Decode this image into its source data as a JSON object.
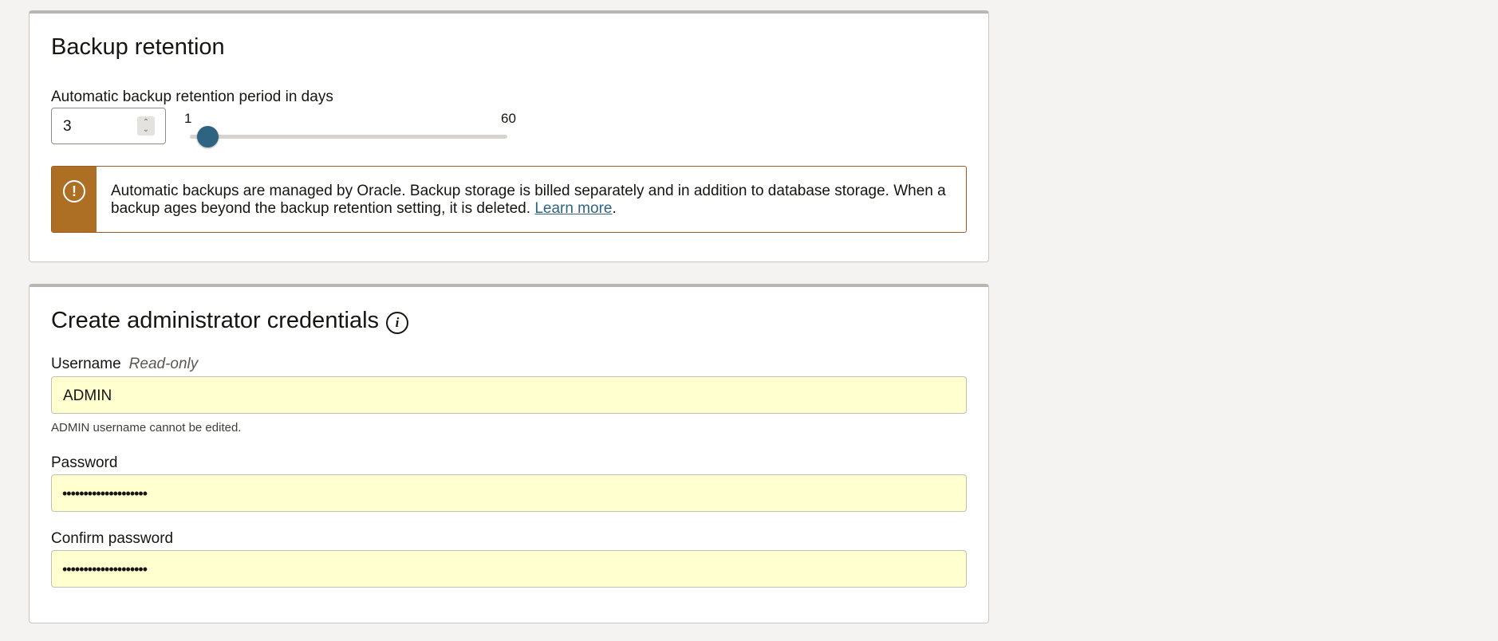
{
  "backup_retention": {
    "title": "Backup retention",
    "period_label": "Automatic backup retention period in days",
    "period_value": "3",
    "slider": {
      "min_label": "1",
      "max_label": "60",
      "value": 3,
      "min": 1,
      "max": 60
    },
    "warning": {
      "text": "Automatic backups are managed by Oracle. Backup storage is billed separately and in addition to database storage. When a backup ages beyond the backup retention setting, it is deleted.",
      "link_label": "Learn more",
      "suffix": "."
    }
  },
  "admin_credentials": {
    "title": "Create administrator credentials",
    "username_label": "Username",
    "readonly_tag": "Read-only",
    "username_value": "ADMIN",
    "username_helper": "ADMIN username cannot be edited.",
    "password_label": "Password",
    "password_value": "••••••••••••••••••••",
    "confirm_label": "Confirm password",
    "confirm_value": "••••••••••••••••••••"
  },
  "icons": {
    "warning": "exclamation-circle-icon",
    "info": "info-icon",
    "stepper": "chevron-up-down-icon"
  },
  "colors": {
    "warning_stripe": "#ac6f24",
    "slider_thumb": "#2f6382",
    "link": "#2e6385",
    "autofill_bg": "#ffffcf"
  }
}
